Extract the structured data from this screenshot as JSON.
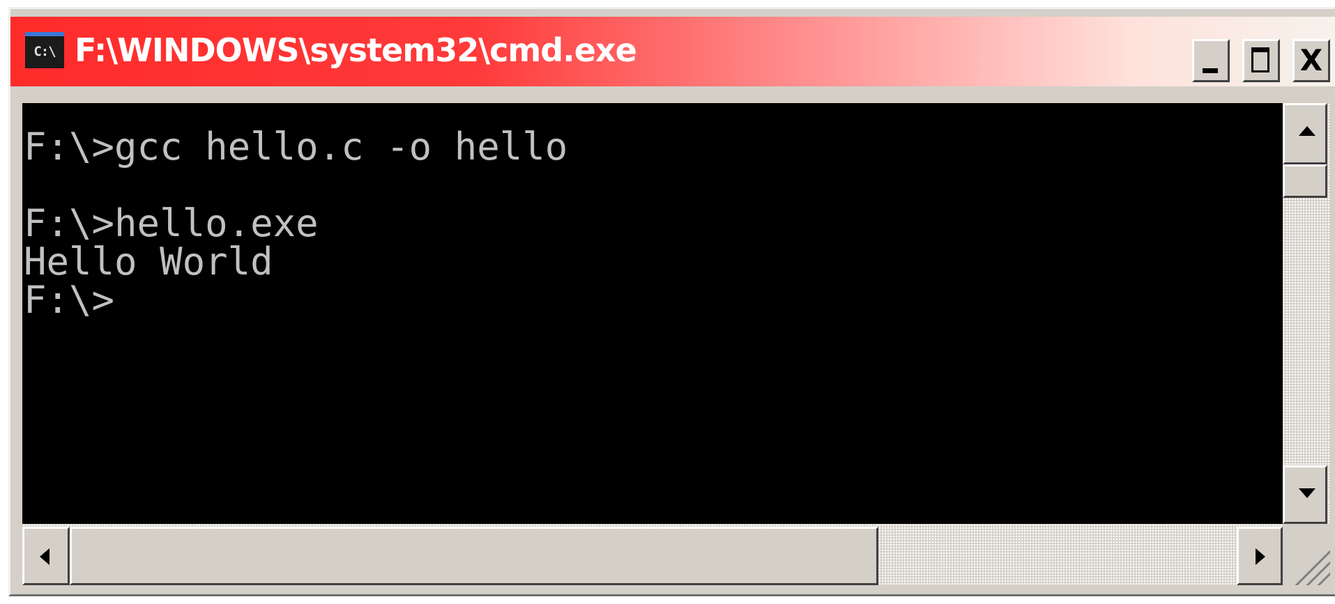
{
  "window": {
    "title": "F:\\WINDOWS\\system32\\cmd.exe",
    "icon": "cmd-console-icon",
    "icon_text": "C:\\",
    "title_gradient_colors": [
      "#ff2b2b",
      "#ff8f8f",
      "#f6f2ec"
    ],
    "controls": {
      "minimize": "minimize-icon",
      "maximize": "maximize-icon",
      "close_label": "X"
    }
  },
  "console": {
    "background": "#000000",
    "text_color": "#c0c0c0",
    "lines": [
      "",
      "F:\\>gcc hello.c -o hello",
      "",
      "F:\\>hello.exe",
      "Hello World",
      "F:\\>"
    ]
  },
  "scrollbars": {
    "vertical": {
      "up_icon": "arrow-up-icon",
      "down_icon": "arrow-down-icon"
    },
    "horizontal": {
      "left_icon": "arrow-left-icon",
      "right_icon": "arrow-right-icon"
    }
  }
}
